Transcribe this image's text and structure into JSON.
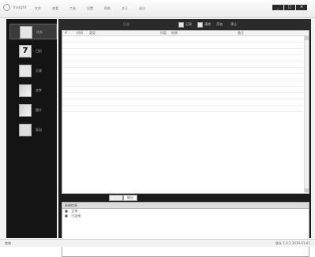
{
  "app": {
    "title": "Insight"
  },
  "menu": [
    "文件",
    "查看",
    "工具",
    "设置",
    "帮助",
    "关于",
    "退出"
  ],
  "window_controls": [
    "_",
    "□",
    "×"
  ],
  "sidebar": {
    "items": [
      {
        "label": "任务",
        "icon": "document-icon",
        "glyph": ""
      },
      {
        "label": "日历",
        "icon": "calendar-icon",
        "glyph": "7"
      },
      {
        "label": "记录",
        "icon": "notes-icon",
        "glyph": ""
      },
      {
        "label": "文件",
        "icon": "folder-icon",
        "glyph": ""
      },
      {
        "label": "图片",
        "icon": "image-icon",
        "glyph": ""
      },
      {
        "label": "导出",
        "icon": "export-icon",
        "glyph": ""
      }
    ]
  },
  "toolbar": {
    "label": "日志",
    "check1": "记录",
    "check2": "清除",
    "btn1": "开始",
    "btn2": "停止"
  },
  "grid": {
    "columns": [
      "#",
      "时间",
      "类型",
      "内容",
      "结果",
      "备注"
    ]
  },
  "tabs": {
    "selected": "输出"
  },
  "log": {
    "title": "系统信息",
    "rows": [
      {
        "k": "■",
        "v": "正常"
      },
      {
        "k": "■",
        "v": "已连接"
      }
    ]
  },
  "status": {
    "left": "就绪",
    "right": "版本 1.0.1 2019-01-01"
  }
}
